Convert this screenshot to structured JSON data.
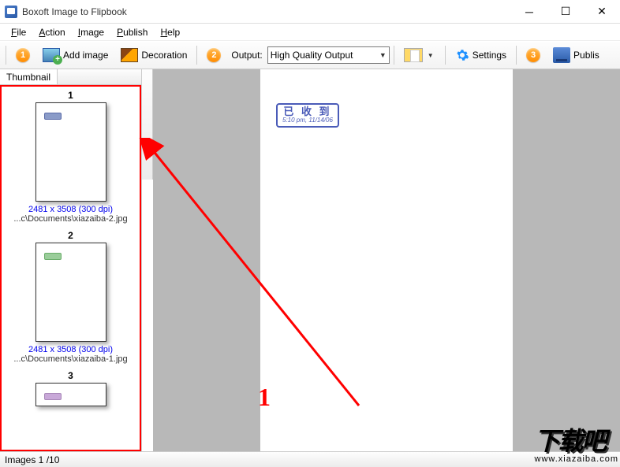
{
  "window": {
    "title": "Boxoft Image to Flipbook"
  },
  "menu": {
    "file": "File",
    "action": "Action",
    "image": "Image",
    "publish": "Publish",
    "help": "Help"
  },
  "toolbar": {
    "step1": "1",
    "add_image": "Add image",
    "decoration": "Decoration",
    "step2": "2",
    "output_label": "Output:",
    "output_value": "High Quality Output",
    "settings": "Settings",
    "step3": "3",
    "publish": "Publis"
  },
  "thumbnail": {
    "tab": "Thumbnail",
    "items": [
      {
        "num": "1",
        "dims": "2481 x 3508 (300 dpi)",
        "path": "...c\\Documents\\xiazaiba-2.jpg",
        "stamp": "blue"
      },
      {
        "num": "2",
        "dims": "2481 x 3508 (300 dpi)",
        "path": "...c\\Documents\\xiazaiba-1.jpg",
        "stamp": "green"
      },
      {
        "num": "3",
        "dims": "",
        "path": "",
        "stamp": "purple"
      }
    ]
  },
  "preview": {
    "stamp_main": "已 收 到",
    "stamp_sub": "5:10 pm, 11/14/06"
  },
  "status": {
    "text": "Images 1 /10"
  },
  "watermark": {
    "main": "下载吧",
    "sub": "www.xiazaiba.com"
  },
  "annotation": {
    "label": "1"
  }
}
